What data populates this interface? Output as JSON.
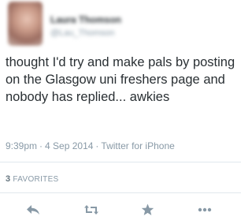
{
  "user": {
    "display_name": "Laura Thomson",
    "screen_name": "@Lau_Thomson"
  },
  "tweet": {
    "text": "thought I'd try and make pals by posting on the Glasgow uni freshers page and nobody has replied... awkies",
    "time": "9:39pm",
    "date": "4 Sep 2014",
    "source": "Twitter for iPhone"
  },
  "stats": {
    "favorites_count": "3",
    "favorites_label": "FAVORITES"
  },
  "actions": {
    "icons": [
      "reply-icon",
      "retweet-icon",
      "favorite-icon",
      "more-icon"
    ]
  },
  "colors": {
    "text": "#292f33",
    "muted": "#8899a6",
    "icon": "#8899a6",
    "divider": "#e1e8ed"
  }
}
